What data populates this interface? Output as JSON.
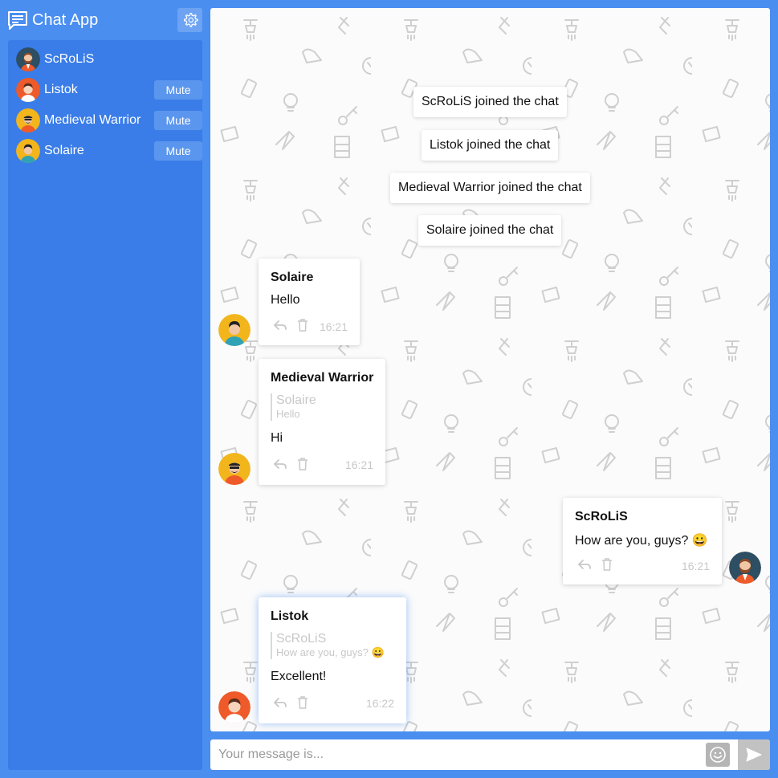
{
  "app": {
    "title": "Chat App",
    "accent_color": "#4a8ef0",
    "logo_icon": "chat-bubble-icon",
    "settings_icon": "gear-icon"
  },
  "users": [
    {
      "name": "ScRoLiS",
      "avatar": "bearded-man-dark-avatar",
      "mute_label": ""
    },
    {
      "name": "Listok",
      "avatar": "man-orange-avatar",
      "mute_label": "Mute"
    },
    {
      "name": "Medieval Warrior",
      "avatar": "mustached-man-yellow-avatar",
      "mute_label": "Mute"
    },
    {
      "name": "Solaire",
      "avatar": "man-yellow-avatar",
      "mute_label": "Mute"
    }
  ],
  "system_messages": [
    "ScRoLiS joined the chat",
    "Listok joined the chat",
    "Medieval Warrior joined the chat",
    "Solaire joined the chat"
  ],
  "messages": [
    {
      "author": "Solaire",
      "text": "Hello",
      "time": "16:21"
    },
    {
      "author": "Medieval Warrior",
      "reply_author": "Solaire",
      "reply_text": "Hello",
      "text": "Hi",
      "time": "16:21"
    },
    {
      "author": "ScRoLiS",
      "text": "How are you, guys? 😀",
      "time": "16:21"
    },
    {
      "author": "Listok",
      "reply_author": "ScRoLiS",
      "reply_text": "How are you, guys? 😀",
      "text": "Excellent!",
      "time": "16:22"
    }
  ],
  "input": {
    "placeholder": "Your message is...",
    "value": "",
    "emoji_icon": "smiley-icon",
    "send_icon": "send-icon"
  }
}
